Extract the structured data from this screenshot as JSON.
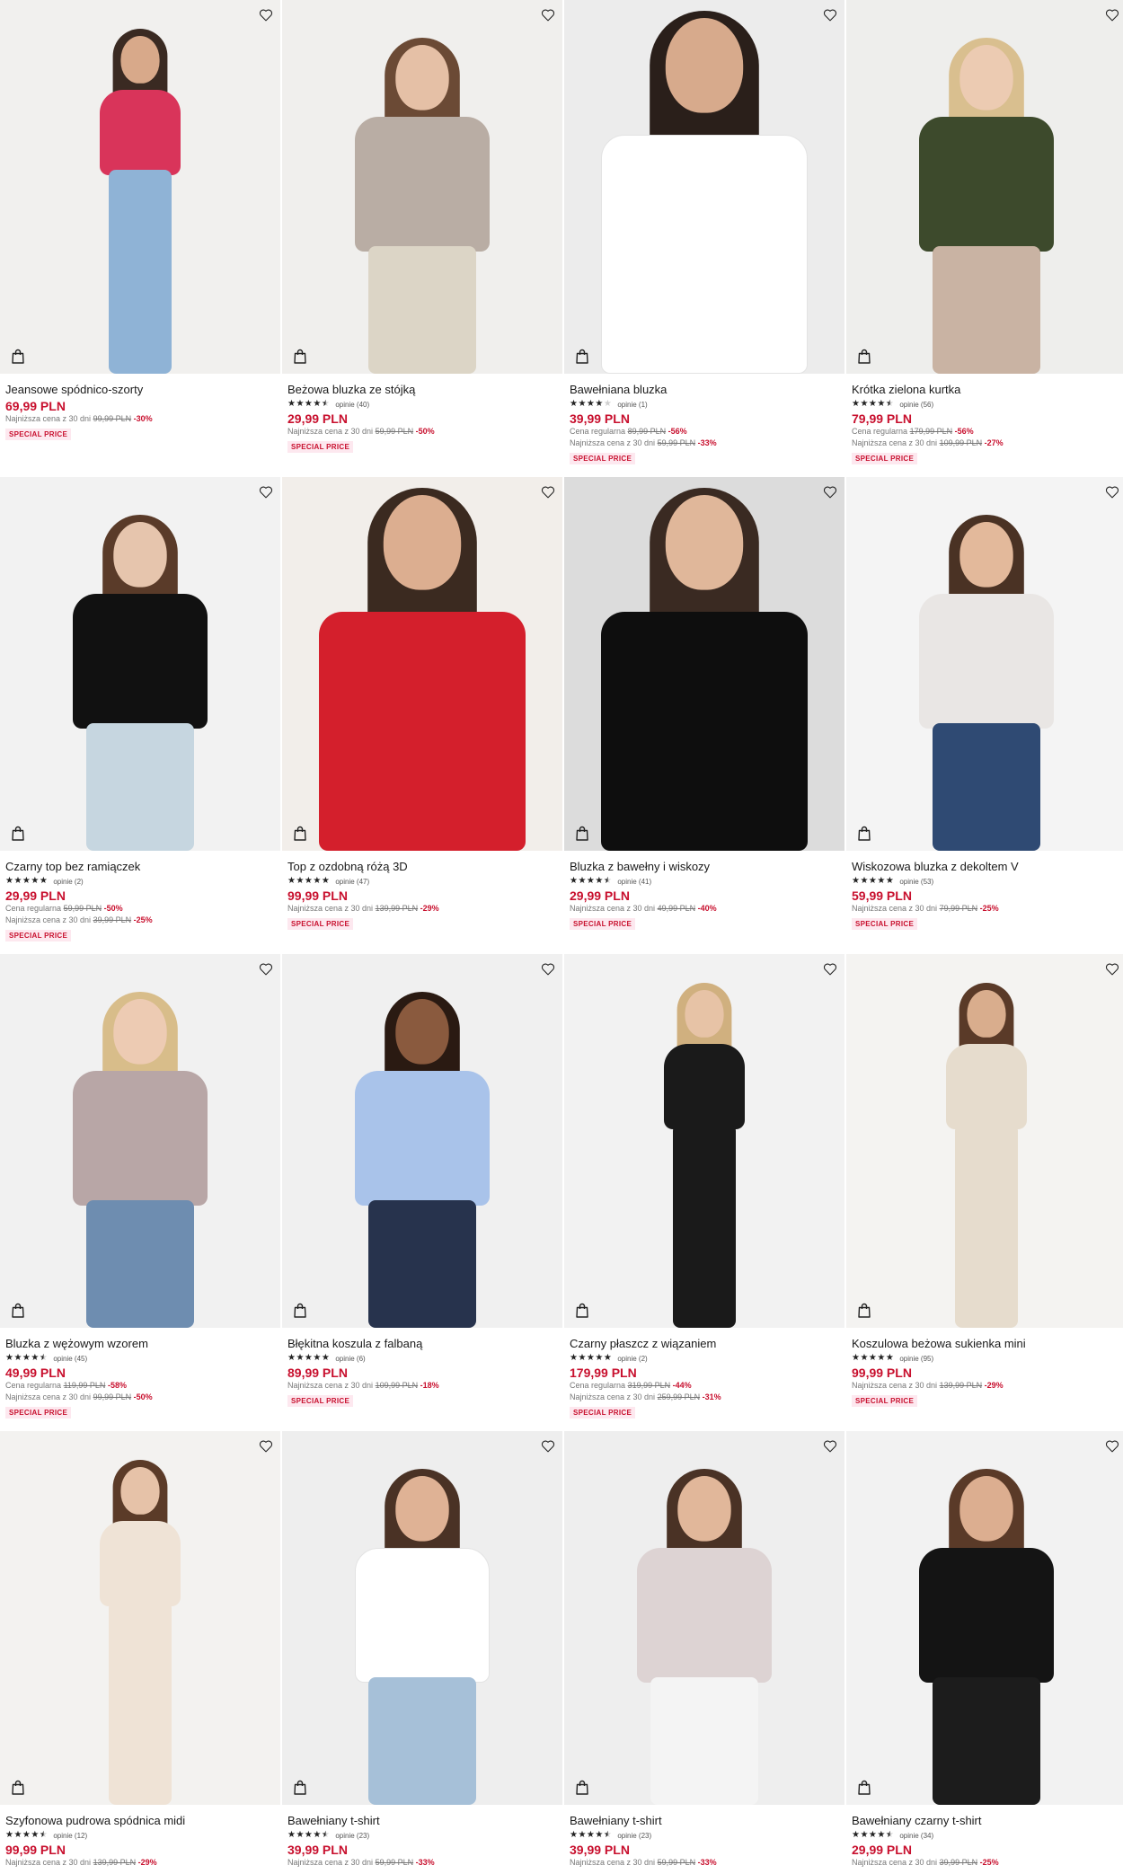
{
  "colors": {
    "price": "#c8102e",
    "badge_bg": "#fde8ef",
    "text": "#1a1a1a"
  },
  "products": [
    {
      "name": "Jeansowe spódnico-szorty",
      "rating": null,
      "opinions": "",
      "price": "69,99 PLN",
      "notes": [
        {
          "label": "Najniższa cena z 30 dni",
          "old": "99,99 PLN",
          "pct": "-30%"
        }
      ],
      "badge": "SPECIAL PRICE"
    },
    {
      "name": "Beżowa bluzka ze stójką",
      "rating": 4.5,
      "opinions": "opinie (40)",
      "price": "29,99 PLN",
      "notes": [
        {
          "label": "Najniższa cena z 30 dni",
          "old": "59,99 PLN",
          "pct": "-50%"
        }
      ],
      "badge": "SPECIAL PRICE"
    },
    {
      "name": "Bawełniana bluzka",
      "rating": 4,
      "opinions": "opinie (1)",
      "price": "39,99 PLN",
      "notes": [
        {
          "label": "Cena regularna",
          "old": "89,99 PLN",
          "pct": "-56%"
        },
        {
          "label": "Najniższa cena z 30 dni",
          "old": "59,99 PLN",
          "pct": "-33%"
        }
      ],
      "badge": "SPECIAL PRICE"
    },
    {
      "name": "Krótka zielona kurtka",
      "rating": 4.5,
      "opinions": "opinie (56)",
      "price": "79,99 PLN",
      "notes": [
        {
          "label": "Cena regularna",
          "old": "179,99 PLN",
          "pct": "-56%"
        },
        {
          "label": "Najniższa cena z 30 dni",
          "old": "109,99 PLN",
          "pct": "-27%"
        }
      ],
      "badge": "SPECIAL PRICE"
    },
    {
      "name": "Czarny top bez ramiączek",
      "rating": 5,
      "opinions": "opinie (2)",
      "price": "29,99 PLN",
      "notes": [
        {
          "label": "Cena regularna",
          "old": "59,99 PLN",
          "pct": "-50%"
        },
        {
          "label": "Najniższa cena z 30 dni",
          "old": "39,99 PLN",
          "pct": "-25%"
        }
      ],
      "badge": "SPECIAL PRICE"
    },
    {
      "name": "Top z ozdobną różą 3D",
      "rating": 5,
      "opinions": "opinie (47)",
      "price": "99,99 PLN",
      "notes": [
        {
          "label": "Najniższa cena z 30 dni",
          "old": "139,99 PLN",
          "pct": "-29%"
        }
      ],
      "badge": "SPECIAL PRICE"
    },
    {
      "name": "Bluzka z bawełny i wiskozy",
      "rating": 4.5,
      "opinions": "opinie (41)",
      "price": "29,99 PLN",
      "notes": [
        {
          "label": "Najniższa cena z 30 dni",
          "old": "49,99 PLN",
          "pct": "-40%"
        }
      ],
      "badge": "SPECIAL PRICE"
    },
    {
      "name": "Wiskozowa bluzka z dekoltem V",
      "rating": 5,
      "opinions": "opinie (53)",
      "price": "59,99 PLN",
      "notes": [
        {
          "label": "Najniższa cena z 30 dni",
          "old": "79,99 PLN",
          "pct": "-25%"
        }
      ],
      "badge": "SPECIAL PRICE"
    },
    {
      "name": "Bluzka z wężowym wzorem",
      "rating": 4.5,
      "opinions": "opinie (45)",
      "price": "49,99 PLN",
      "notes": [
        {
          "label": "Cena regularna",
          "old": "119,99 PLN",
          "pct": "-58%"
        },
        {
          "label": "Najniższa cena z 30 dni",
          "old": "99,99 PLN",
          "pct": "-50%"
        }
      ],
      "badge": "SPECIAL PRICE"
    },
    {
      "name": "Błękitna koszula z falbaną",
      "rating": 5,
      "opinions": "opinie (6)",
      "price": "89,99 PLN",
      "notes": [
        {
          "label": "Najniższa cena z 30 dni",
          "old": "109,99 PLN",
          "pct": "-18%"
        }
      ],
      "badge": "SPECIAL PRICE"
    },
    {
      "name": "Czarny płaszcz z wiązaniem",
      "rating": 5,
      "opinions": "opinie (2)",
      "price": "179,99 PLN",
      "notes": [
        {
          "label": "Cena regularna",
          "old": "319,99 PLN",
          "pct": "-44%"
        },
        {
          "label": "Najniższa cena z 30 dni",
          "old": "259,99 PLN",
          "pct": "-31%"
        }
      ],
      "badge": "SPECIAL PRICE"
    },
    {
      "name": "Koszulowa beżowa sukienka mini",
      "rating": 5,
      "opinions": "opinie (95)",
      "price": "99,99 PLN",
      "notes": [
        {
          "label": "Najniższa cena z 30 dni",
          "old": "139,99 PLN",
          "pct": "-29%"
        }
      ],
      "badge": "SPECIAL PRICE"
    },
    {
      "name": "Szyfonowa pudrowa spódnica midi",
      "rating": 4.5,
      "opinions": "opinie (12)",
      "price": "99,99 PLN",
      "notes": [
        {
          "label": "Najniższa cena z 30 dni",
          "old": "139,99 PLN",
          "pct": "-29%"
        }
      ],
      "badge": ""
    },
    {
      "name": "Bawełniany t-shirt",
      "rating": 4.5,
      "opinions": "opinie (23)",
      "price": "39,99 PLN",
      "notes": [
        {
          "label": "Najniższa cena z 30 dni",
          "old": "59,99 PLN",
          "pct": "-33%"
        }
      ],
      "badge": ""
    },
    {
      "name": "Bawełniany t-shirt",
      "rating": 4.5,
      "opinions": "opinie (23)",
      "price": "39,99 PLN",
      "notes": [
        {
          "label": "Najniższa cena z 30 dni",
          "old": "59,99 PLN",
          "pct": "-33%"
        }
      ],
      "badge": ""
    },
    {
      "name": "Bawełniany czarny t-shirt",
      "rating": 4.5,
      "opinions": "opinie (34)",
      "price": "29,99 PLN",
      "notes": [
        {
          "label": "Najniższa cena z 30 dni",
          "old": "39,99 PLN",
          "pct": "-25%"
        }
      ],
      "badge": ""
    }
  ],
  "photos": [
    {
      "bg": "#f1f0ee",
      "skin": "#d8a98a",
      "hair": "#3a2a22",
      "top": "#d9345a",
      "bottom": "#8fb3d6",
      "style": "full"
    },
    {
      "bg": "#f0efed",
      "skin": "#e5c0a6",
      "hair": "#6b4a35",
      "top": "#b9ada4",
      "bottom": "#dcd5c6",
      "style": "half"
    },
    {
      "bg": "#ececec",
      "skin": "#d7aa8c",
      "hair": "#2a1f1a",
      "top": "#ffffff",
      "bottom": "#ffffff",
      "style": "close"
    },
    {
      "bg": "#eeeeec",
      "skin": "#eccbb2",
      "hair": "#d9bf8f",
      "top": "#3d4a2c",
      "bottom": "#c9b3a3",
      "style": "half"
    },
    {
      "bg": "#f2f2f2",
      "skin": "#e6c5ad",
      "hair": "#5a3b29",
      "top": "#111111",
      "bottom": "#c6d6e0",
      "style": "half"
    },
    {
      "bg": "#f2eeea",
      "skin": "#dcae90",
      "hair": "#3b2a20",
      "top": "#d41f2c",
      "bottom": "#1d2233",
      "style": "close"
    },
    {
      "bg": "#dcdcdc",
      "skin": "#e0b79a",
      "hair": "#3a2a22",
      "top": "#0e0e0e",
      "bottom": "#0e0e0e",
      "style": "close"
    },
    {
      "bg": "#f4f4f4",
      "skin": "#e3b99b",
      "hair": "#4a3224",
      "top": "#e9e6e4",
      "bottom": "#2f4a73",
      "style": "half"
    },
    {
      "bg": "#f1f1f1",
      "skin": "#edcbb3",
      "hair": "#d8bd8a",
      "top": "#b8a6a6",
      "bottom": "#6e8db0",
      "style": "half"
    },
    {
      "bg": "#f0f0f0",
      "skin": "#8a5a3e",
      "hair": "#2a1a12",
      "top": "#a9c3ea",
      "bottom": "#27334d",
      "style": "half"
    },
    {
      "bg": "#f2f2f2",
      "skin": "#e7c3a6",
      "hair": "#d0b07f",
      "top": "#1a1a1a",
      "bottom": "#1a1a1a",
      "style": "full"
    },
    {
      "bg": "#f4f3f1",
      "skin": "#d9ad8d",
      "hair": "#5a3a28",
      "top": "#e6dccd",
      "bottom": "#e6dccd",
      "style": "full"
    },
    {
      "bg": "#f3f2f0",
      "skin": "#e6c2a8",
      "hair": "#5b3b28",
      "top": "#efe3d6",
      "bottom": "#efe3d6",
      "style": "full"
    },
    {
      "bg": "#eeeeee",
      "skin": "#dfb295",
      "hair": "#4a3225",
      "top": "#ffffff",
      "bottom": "#a6c0d8",
      "style": "half"
    },
    {
      "bg": "#eeeeee",
      "skin": "#e1b79a",
      "hair": "#4a3225",
      "top": "#ddd3d3",
      "bottom": "#f4f4f4",
      "style": "half"
    },
    {
      "bg": "#f2f2f2",
      "skin": "#dcae90",
      "hair": "#5a3a28",
      "top": "#141414",
      "bottom": "#1c1c1c",
      "style": "half"
    }
  ]
}
